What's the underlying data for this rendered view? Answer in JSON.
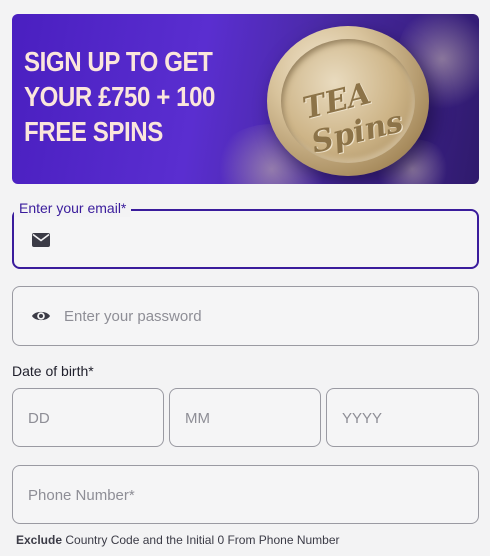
{
  "banner": {
    "headline": "SIGN UP TO GET YOUR £750 + 100 FREE SPINS",
    "logo_text": "TEA Spins"
  },
  "email": {
    "label": "Enter your email*",
    "value": "",
    "placeholder": "",
    "icon": "envelope-icon"
  },
  "password": {
    "placeholder": "Enter your password",
    "value": "",
    "icon": "eye-icon"
  },
  "dob": {
    "label": "Date of birth*",
    "day_placeholder": "DD",
    "month_placeholder": "MM",
    "year_placeholder": "YYYY"
  },
  "phone": {
    "placeholder": "Phone Number*",
    "hint_bold": "Exclude",
    "hint_rest": " Country Code and the Initial 0 From Phone Number"
  },
  "colors": {
    "accent": "#3a1c9c",
    "banner_bg": "#4a1fc0",
    "headline": "#fbe6dc"
  }
}
